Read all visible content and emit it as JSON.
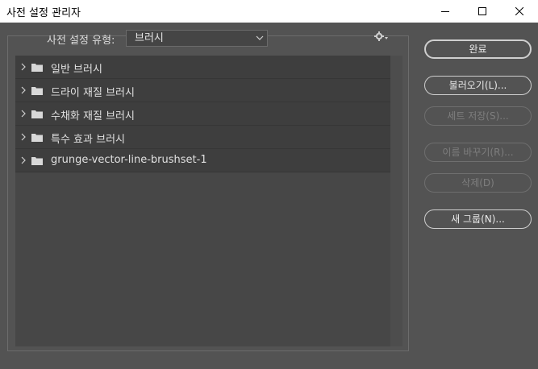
{
  "window": {
    "title": "사전 설정 관리자",
    "minimize_icon": "minimize-icon",
    "maximize_icon": "maximize-icon",
    "close_icon": "close-icon"
  },
  "preset_type": {
    "label": "사전 설정 유형:",
    "value": "브러시",
    "gear_icon": "gear-icon"
  },
  "presets": [
    {
      "label": "일반 브러시",
      "icon": "folder-icon"
    },
    {
      "label": "드라이 재질 브러시",
      "icon": "folder-icon"
    },
    {
      "label": "수채화 재질 브러시",
      "icon": "folder-icon"
    },
    {
      "label": "특수 효과 브러시",
      "icon": "folder-icon"
    },
    {
      "label": "grunge-vector-line-brushset-1",
      "icon": "folder-icon"
    }
  ],
  "buttons": {
    "done": "완료",
    "load": "불러오기(L)...",
    "save_set": "세트 저장(S)...",
    "rename": "이름 바꾸기(R)...",
    "delete": "삭제(D)",
    "new_group": "새 그룹(N)..."
  },
  "colors": {
    "background": "#535353",
    "list_background": "#474747",
    "item_background": "#3e3e3e",
    "text": "#e0e0e0",
    "disabled_text": "#7e7e7e"
  }
}
